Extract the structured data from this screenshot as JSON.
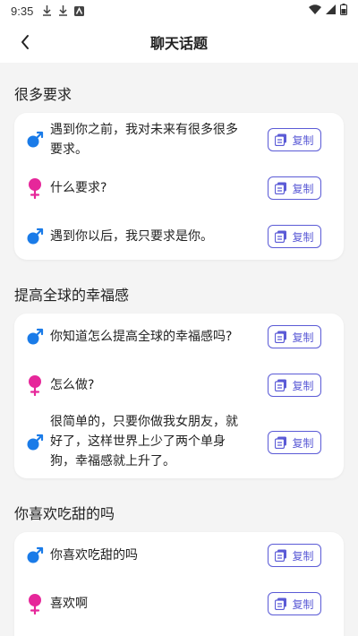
{
  "status_bar": {
    "time": "9:35"
  },
  "nav": {
    "title": "聊天话题"
  },
  "copy_label": "复制",
  "colors": {
    "accent": "#5b5bd6",
    "male": "#1a7be8",
    "female": "#e6279a"
  },
  "sections": [
    {
      "title": "很多要求",
      "rows": [
        {
          "gender": "male",
          "text": "遇到你之前，我对未来有很多很多要求。"
        },
        {
          "gender": "female",
          "text": "什么要求?"
        },
        {
          "gender": "male",
          "text": "遇到你以后，我只要求是你。"
        }
      ]
    },
    {
      "title": "提高全球的幸福感",
      "rows": [
        {
          "gender": "male",
          "text": "你知道怎么提高全球的幸福感吗?"
        },
        {
          "gender": "female",
          "text": "怎么做?"
        },
        {
          "gender": "male",
          "text": "很简单的，只要你做我女朋友，就好了，这样世界上少了两个单身狗，幸福感就上升了。"
        }
      ]
    },
    {
      "title": "你喜欢吃甜的吗",
      "rows": [
        {
          "gender": "male",
          "text": "你喜欢吃甜的吗"
        },
        {
          "gender": "female",
          "text": "喜欢啊"
        }
      ]
    }
  ]
}
